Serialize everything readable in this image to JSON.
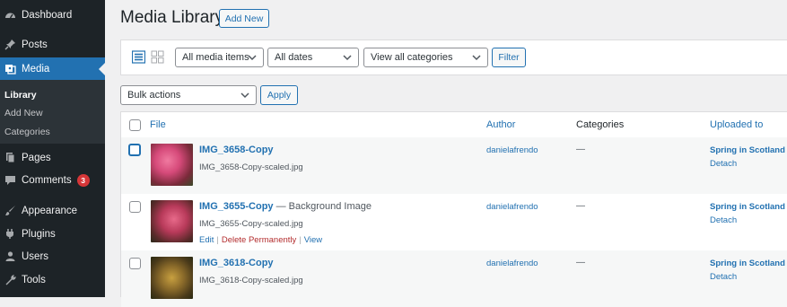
{
  "sidebar": {
    "items": [
      {
        "label": "Dashboard",
        "icon": "dashboard-icon"
      },
      {
        "label": "Posts",
        "icon": "pin-icon"
      },
      {
        "label": "Media",
        "icon": "media-icon"
      },
      {
        "label": "Pages",
        "icon": "page-icon"
      },
      {
        "label": "Comments",
        "icon": "comment-icon",
        "badge": "3"
      },
      {
        "label": "Appearance",
        "icon": "paintbrush-icon"
      },
      {
        "label": "Plugins",
        "icon": "plugin-icon"
      },
      {
        "label": "Users",
        "icon": "users-icon"
      },
      {
        "label": "Tools",
        "icon": "wrench-icon"
      }
    ],
    "submenu": [
      "Library",
      "Add New",
      "Categories"
    ]
  },
  "header": {
    "title": "Media Library",
    "add_new": "Add New"
  },
  "filters": {
    "media_items": "All media items",
    "dates": "All dates",
    "categories": "View all categories",
    "filter_button": "Filter"
  },
  "bulk": {
    "select": "Bulk actions",
    "apply": "Apply"
  },
  "table": {
    "columns": [
      "File",
      "Author",
      "Categories",
      "Uploaded to"
    ],
    "rows": [
      {
        "title": "IMG_3658-Copy",
        "suffix": "",
        "filename": "IMG_3658-Copy-scaled.jpg",
        "author": "danielafrendo",
        "categories": "—",
        "uploaded_to": "Spring in Scotland",
        "detach": "Detach",
        "actions": []
      },
      {
        "title": "IMG_3655-Copy",
        "suffix": " — Background Image",
        "filename": "IMG_3655-Copy-scaled.jpg",
        "author": "danielafrendo",
        "categories": "—",
        "uploaded_to": "Spring in Scotland",
        "detach": "Detach",
        "actions": [
          "Edit",
          "Delete Permanently",
          "View"
        ]
      },
      {
        "title": "IMG_3618-Copy",
        "suffix": "",
        "filename": "IMG_3618-Copy-scaled.jpg",
        "author": "danielafrendo",
        "categories": "—",
        "uploaded_to": "Spring in Scotland",
        "detach": "Detach",
        "actions": []
      }
    ]
  },
  "colors": {
    "sidebar_bg": "#1d2327",
    "accent": "#2271b1",
    "badge": "#d63638",
    "danger": "#b32d2e"
  }
}
